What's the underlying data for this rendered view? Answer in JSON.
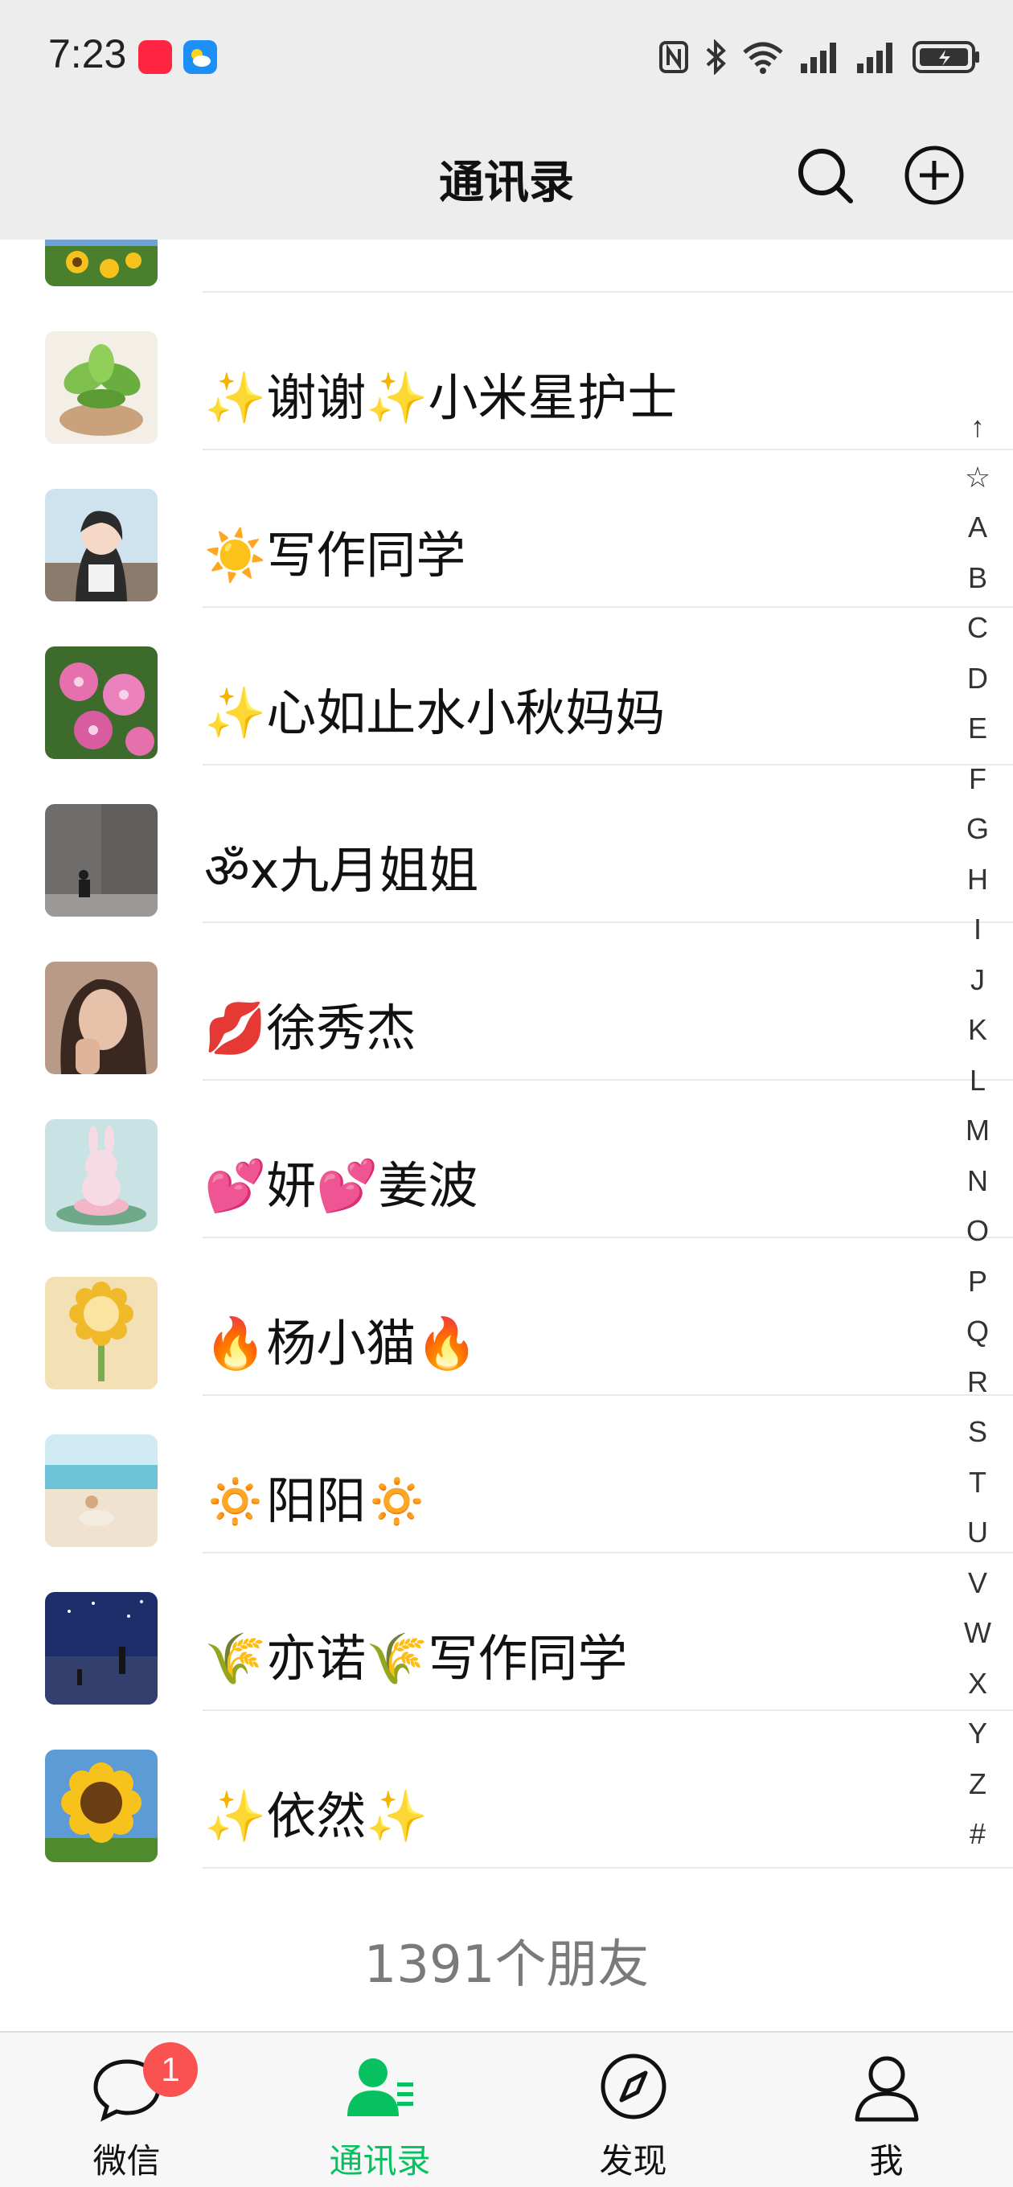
{
  "status_bar": {
    "time": "7:23",
    "left_icons": [
      "xiaohongshu-app-icon",
      "weather-app-icon"
    ],
    "right_icons": [
      "nfc-icon",
      "bluetooth-icon",
      "wifi-icon",
      "signal-icon",
      "signal-icon",
      "battery-icon"
    ]
  },
  "header": {
    "title": "通讯录",
    "search_icon": "search-icon",
    "add_icon": "plus-circle-icon"
  },
  "contacts": [
    {
      "name": "",
      "avatar": "sunflower-field"
    },
    {
      "name": "✨谢谢✨小米星护士",
      "avatar": "succulent-plant"
    },
    {
      "name": "☀️写作同学",
      "avatar": "anime-girl"
    },
    {
      "name": "✨心如止水小秋妈妈",
      "avatar": "pink-flowers"
    },
    {
      "name": "ॐx九月姐姐",
      "avatar": "person-on-concrete"
    },
    {
      "name": "💋徐秀杰",
      "avatar": "woman-portrait"
    },
    {
      "name": "💕妍💕姜波",
      "avatar": "bunny-on-lotus"
    },
    {
      "name": "🔥杨小猫🔥",
      "avatar": "cartoon-sunflower"
    },
    {
      "name": "🔅阳阳🔅",
      "avatar": "beach-photo"
    },
    {
      "name": "🌾亦诺🌾写作同学",
      "avatar": "night-sky-anime"
    },
    {
      "name": "✨依然✨",
      "avatar": "sunflower"
    }
  ],
  "friend_count": "1391个朋友",
  "alphabet_index": [
    "↑",
    "☆",
    "A",
    "B",
    "C",
    "D",
    "E",
    "F",
    "G",
    "H",
    "I",
    "J",
    "K",
    "L",
    "M",
    "N",
    "O",
    "P",
    "Q",
    "R",
    "S",
    "T",
    "U",
    "V",
    "W",
    "X",
    "Y",
    "Z",
    "#"
  ],
  "tabs": [
    {
      "label": "微信",
      "icon": "chat-bubble-icon",
      "badge": "1",
      "active": false
    },
    {
      "label": "通讯录",
      "icon": "contacts-icon",
      "active": true
    },
    {
      "label": "发现",
      "icon": "compass-icon",
      "active": false
    },
    {
      "label": "我",
      "icon": "person-icon",
      "active": false
    }
  ],
  "colors": {
    "accent": "#07c160",
    "badge": "#fa5151",
    "header_bg": "#ededed",
    "tabbar_bg": "#f7f7f7"
  }
}
